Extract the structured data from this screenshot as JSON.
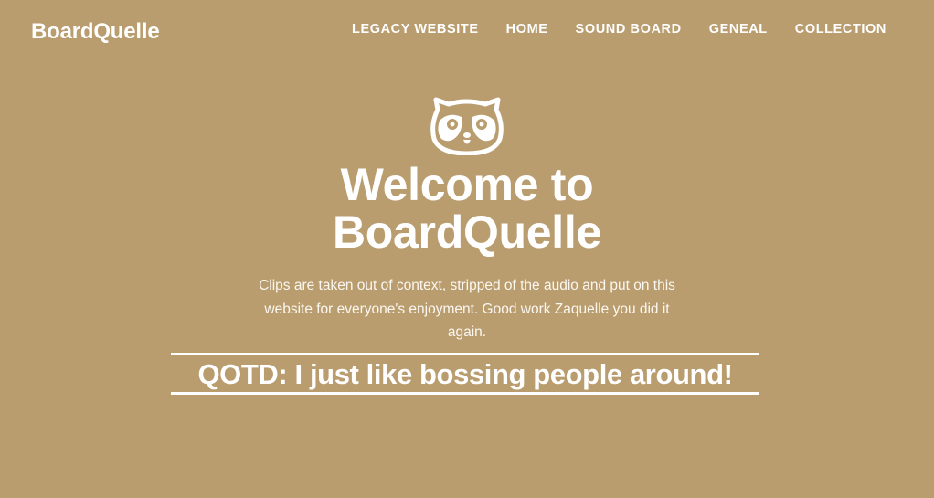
{
  "brand": {
    "name": "BoardQuelle"
  },
  "nav": {
    "items": [
      {
        "label": "LEGACY WEBSITE"
      },
      {
        "label": "HOME"
      },
      {
        "label": "SOUND BOARD"
      },
      {
        "label": "GENEAL"
      },
      {
        "label": "COLLECTION"
      }
    ]
  },
  "hero": {
    "logo_icon": "raccoon-mascot-icon",
    "title_line1": "Welcome to",
    "title_line2": "BoardQuelle",
    "description": "Clips are taken out of context, stripped of the audio and put on this website for everyone's enjoyment. Good work Zaquelle you did it again.",
    "qotd": "QOTD: I just like bossing people around!"
  },
  "colors": {
    "background": "#b99d6f",
    "text": "#ffffff"
  }
}
